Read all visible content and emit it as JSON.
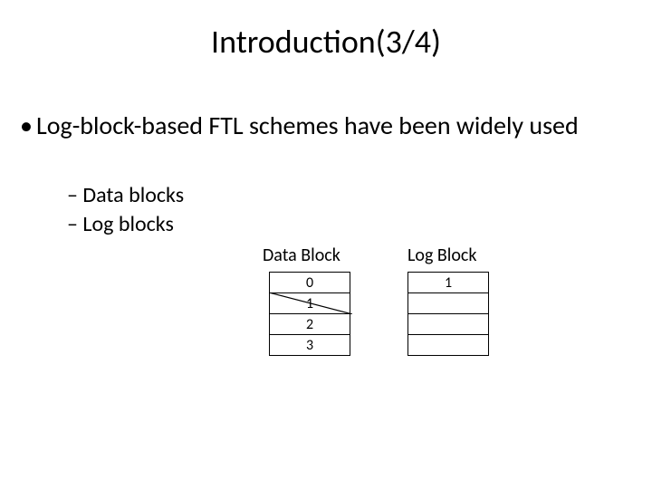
{
  "title": "Introduction(3/4)",
  "bullet1": "Log-block-based FTL schemes have been widely used",
  "sub": {
    "a": "Data blocks",
    "b": "Log blocks"
  },
  "labels": {
    "data": "Data Block",
    "log": "Log Block"
  },
  "data_block": {
    "r0": "0",
    "r1": "1",
    "r2": "2",
    "r3": "3",
    "r1_struck": true
  },
  "log_block": {
    "r0": "1",
    "r1": "",
    "r2": "",
    "r3": ""
  }
}
